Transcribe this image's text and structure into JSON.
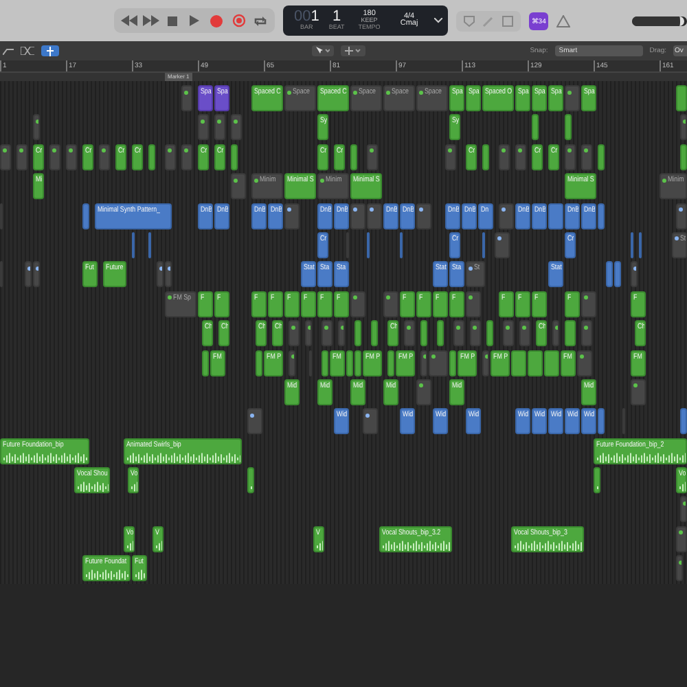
{
  "transport": {
    "buttons": [
      {
        "kind": "rewind"
      },
      {
        "kind": "forward"
      },
      {
        "kind": "stop"
      },
      {
        "kind": "play"
      },
      {
        "kind": "record"
      },
      {
        "kind": "replace"
      },
      {
        "kind": "cycle"
      }
    ]
  },
  "lcd": {
    "bar_dim": "00",
    "bar": "1",
    "beat": "1",
    "bar_label": "BAR",
    "beat_label": "BEAT",
    "tempo": "180",
    "tempo_mode": "KEEP",
    "tempo_label": "TEMPO",
    "signature": "4/4",
    "key": "Cmaj"
  },
  "badge": "⌘34",
  "master_volume": {
    "level": 0.95
  },
  "edit_bar": {
    "snap_label": "Snap:",
    "snap_value": "Smart",
    "drag_label": "Drag:",
    "drag_value": "Ov"
  },
  "ruler": [
    "1",
    "17",
    "33",
    "49",
    "65",
    "81",
    "97",
    "113",
    "129",
    "145",
    "161"
  ],
  "marker": {
    "label": "Marker 1"
  },
  "tracks": [
    {
      "kind": "synth",
      "regions": [
        {
          "kind": "muted"
        },
        {
          "kind": "drum",
          "label": "Spa"
        },
        {
          "kind": "drum",
          "label": "Spa"
        },
        {
          "kind": "midi",
          "label": "Spaced C"
        },
        {
          "kind": "muted",
          "label": "Space"
        },
        {
          "kind": "midi",
          "label": "Spaced C"
        },
        {
          "kind": "muted",
          "label": "Space"
        },
        {
          "kind": "muted",
          "label": "Space"
        },
        {
          "kind": "muted",
          "label": "Space"
        },
        {
          "kind": "midi",
          "label": "Spa"
        },
        {
          "kind": "midi",
          "label": "Spa"
        },
        {
          "kind": "midi",
          "label": "Spaced O"
        },
        {
          "kind": "midi",
          "label": "Spa"
        },
        {
          "kind": "midi",
          "label": "Spa"
        },
        {
          "kind": "midi",
          "label": "Spa"
        },
        {
          "kind": "muted"
        },
        {
          "kind": "midi",
          "label": "Spa"
        },
        {
          "kind": "midi"
        }
      ]
    },
    {
      "kind": "synth",
      "regions": [
        {
          "kind": "muted"
        },
        {
          "kind": "muted"
        },
        {
          "kind": "muted"
        },
        {
          "kind": "muted"
        },
        {
          "kind": "midi",
          "label": "Sy"
        },
        {
          "kind": "midi",
          "label": "Sy"
        },
        {
          "kind": "midi"
        },
        {
          "kind": "midi"
        },
        {
          "kind": "muted"
        }
      ]
    },
    {
      "kind": "synth",
      "regions": [
        {
          "kind": "muted"
        },
        {
          "kind": "muted"
        },
        {
          "kind": "midi",
          "label": "Cr"
        },
        {
          "kind": "muted"
        },
        {
          "kind": "muted"
        },
        {
          "kind": "midi",
          "label": "Cr"
        },
        {
          "kind": "muted"
        },
        {
          "kind": "midi",
          "label": "Cr"
        },
        {
          "kind": "midi",
          "label": "Cr"
        },
        {
          "kind": "midi"
        },
        {
          "kind": "muted"
        },
        {
          "kind": "muted"
        },
        {
          "kind": "midi",
          "label": "Cr"
        },
        {
          "kind": "midi",
          "label": "Cr"
        },
        {
          "kind": "midi"
        },
        {
          "kind": "midi",
          "label": "Cr"
        },
        {
          "kind": "midi",
          "label": "Cr"
        },
        {
          "kind": "midi"
        },
        {
          "kind": "muted"
        },
        {
          "kind": "muted"
        },
        {
          "kind": "midi",
          "label": "Cr"
        },
        {
          "kind": "midi"
        },
        {
          "kind": "muted"
        },
        {
          "kind": "muted"
        },
        {
          "kind": "midi",
          "label": "Cr"
        },
        {
          "kind": "midi",
          "label": "Cr"
        },
        {
          "kind": "muted"
        },
        {
          "kind": "muted"
        },
        {
          "kind": "midi"
        },
        {
          "kind": "midi"
        }
      ]
    },
    {
      "kind": "synth",
      "regions": [
        {
          "kind": "midi",
          "label": "Mi"
        },
        {
          "kind": "muted"
        },
        {
          "kind": "muted",
          "label": "Minim"
        },
        {
          "kind": "midi",
          "label": "Minimal S"
        },
        {
          "kind": "muted",
          "label": "Minim"
        },
        {
          "kind": "midi",
          "label": "Minimal S"
        },
        {
          "kind": "midi",
          "label": "Minimal S"
        },
        {
          "kind": "muted",
          "label": "Minim"
        }
      ]
    },
    {
      "kind": "pattern",
      "regions": [
        {
          "kind": "muted"
        },
        {
          "kind": "pattern"
        },
        {
          "kind": "pattern",
          "label": "Minimal Synth Pattern_"
        },
        {
          "kind": "pattern",
          "label": "DnB"
        },
        {
          "kind": "pattern",
          "label": "DnB"
        },
        {
          "kind": "pattern",
          "label": "DnB"
        },
        {
          "kind": "pattern",
          "label": "DnB"
        },
        {
          "kind": "muted"
        },
        {
          "kind": "pattern",
          "label": "DnB"
        },
        {
          "kind": "pattern",
          "label": "DnB"
        },
        {
          "kind": "muted"
        },
        {
          "kind": "muted"
        },
        {
          "kind": "pattern",
          "label": "DnB"
        },
        {
          "kind": "pattern",
          "label": "DnB"
        },
        {
          "kind": "muted"
        },
        {
          "kind": "pattern",
          "label": "DnB"
        },
        {
          "kind": "pattern",
          "label": "DnB"
        },
        {
          "kind": "pattern",
          "label": "Dn"
        },
        {
          "kind": "muted"
        },
        {
          "kind": "pattern",
          "label": "DnB"
        },
        {
          "kind": "pattern",
          "label": "DnB"
        },
        {
          "kind": "pattern"
        },
        {
          "kind": "pattern",
          "label": "DnB"
        },
        {
          "kind": "pattern",
          "label": "DnB"
        },
        {
          "kind": "pattern"
        },
        {
          "kind": "muted"
        }
      ]
    },
    {
      "kind": "pattern",
      "regions": [
        {
          "kind": "pattern"
        },
        {
          "kind": "pattern"
        },
        {
          "kind": "pattern",
          "label": "Cr"
        },
        {
          "kind": "muted"
        },
        {
          "kind": "pattern"
        },
        {
          "kind": "pattern"
        },
        {
          "kind": "pattern",
          "label": "Cr"
        },
        {
          "kind": "pattern"
        },
        {
          "kind": "muted"
        },
        {
          "kind": "pattern",
          "label": "Cr"
        },
        {
          "kind": "pattern"
        },
        {
          "kind": "pattern"
        },
        {
          "kind": "muted",
          "label": "St"
        }
      ]
    },
    {
      "kind": "pattern",
      "regions": [
        {
          "kind": "muted"
        },
        {
          "kind": "muted"
        },
        {
          "kind": "muted"
        },
        {
          "kind": "midi",
          "label": "Fut"
        },
        {
          "kind": "midi",
          "label": "Future"
        },
        {
          "kind": "muted"
        },
        {
          "kind": "muted"
        },
        {
          "kind": "pattern",
          "label": "Stat"
        },
        {
          "kind": "pattern",
          "label": "Sta"
        },
        {
          "kind": "pattern",
          "label": "Sta"
        },
        {
          "kind": "pattern",
          "label": "Stat"
        },
        {
          "kind": "pattern",
          "label": "Sta"
        },
        {
          "kind": "muted",
          "label": "St"
        },
        {
          "kind": "pattern",
          "label": "Stat"
        },
        {
          "kind": "pattern"
        },
        {
          "kind": "pattern"
        },
        {
          "kind": "muted"
        }
      ]
    },
    {
      "kind": "synth",
      "regions": [
        {
          "kind": "muted",
          "label": "FM Sp"
        },
        {
          "kind": "midi",
          "label": "F"
        },
        {
          "kind": "midi",
          "label": "F"
        },
        {
          "kind": "midi",
          "label": "F"
        },
        {
          "kind": "midi",
          "label": "F"
        },
        {
          "kind": "midi",
          "label": "F"
        },
        {
          "kind": "midi",
          "label": "F"
        },
        {
          "kind": "midi",
          "label": "F"
        },
        {
          "kind": "midi",
          "label": "F"
        },
        {
          "kind": "muted"
        },
        {
          "kind": "muted"
        },
        {
          "kind": "midi",
          "label": "F"
        },
        {
          "kind": "midi",
          "label": "F"
        },
        {
          "kind": "midi",
          "label": "F"
        },
        {
          "kind": "midi",
          "label": "F"
        },
        {
          "kind": "muted"
        },
        {
          "kind": "midi",
          "label": "F"
        },
        {
          "kind": "midi",
          "label": "F"
        },
        {
          "kind": "midi",
          "label": "F"
        },
        {
          "kind": "midi",
          "label": "F"
        },
        {
          "kind": "muted"
        },
        {
          "kind": "midi",
          "label": "F"
        }
      ]
    },
    {
      "kind": "synth",
      "regions": [
        {
          "kind": "midi",
          "label": "Ch"
        },
        {
          "kind": "midi",
          "label": "Ch"
        },
        {
          "kind": "midi",
          "label": "Ch"
        },
        {
          "kind": "midi",
          "label": "Ch"
        },
        {
          "kind": "muted"
        },
        {
          "kind": "muted"
        },
        {
          "kind": "muted"
        },
        {
          "kind": "muted"
        },
        {
          "kind": "midi"
        },
        {
          "kind": "midi"
        },
        {
          "kind": "midi",
          "label": "Ch"
        },
        {
          "kind": "muted"
        },
        {
          "kind": "midi"
        },
        {
          "kind": "midi"
        },
        {
          "kind": "muted"
        },
        {
          "kind": "muted"
        },
        {
          "kind": "midi"
        },
        {
          "kind": "muted"
        },
        {
          "kind": "muted"
        },
        {
          "kind": "midi",
          "label": "Ch"
        },
        {
          "kind": "muted"
        },
        {
          "kind": "midi"
        },
        {
          "kind": "muted"
        },
        {
          "kind": "midi",
          "label": "Ch"
        }
      ]
    },
    {
      "kind": "synth",
      "regions": [
        {
          "kind": "midi"
        },
        {
          "kind": "midi",
          "label": "FM"
        },
        {
          "kind": "midi"
        },
        {
          "kind": "midi",
          "label": "FM P"
        },
        {
          "kind": "muted"
        },
        {
          "kind": "muted"
        },
        {
          "kind": "midi"
        },
        {
          "kind": "midi",
          "label": "FM"
        },
        {
          "kind": "midi"
        },
        {
          "kind": "midi"
        },
        {
          "kind": "midi",
          "label": "FM P"
        },
        {
          "kind": "midi"
        },
        {
          "kind": "midi",
          "label": "FM P"
        },
        {
          "kind": "muted"
        },
        {
          "kind": "muted"
        },
        {
          "kind": "midi"
        },
        {
          "kind": "midi",
          "label": "FM P"
        },
        {
          "kind": "muted"
        },
        {
          "kind": "midi",
          "label": "FM P"
        },
        {
          "kind": "midi"
        },
        {
          "kind": "midi"
        },
        {
          "kind": "midi"
        },
        {
          "kind": "midi",
          "label": "FM"
        },
        {
          "kind": "muted"
        },
        {
          "kind": "midi",
          "label": "FM"
        }
      ]
    },
    {
      "kind": "synth",
      "regions": [
        {
          "kind": "midi",
          "label": "Mid"
        },
        {
          "kind": "midi",
          "label": "Mid"
        },
        {
          "kind": "midi",
          "label": "Mid"
        },
        {
          "kind": "midi",
          "label": "Mid"
        },
        {
          "kind": "muted"
        },
        {
          "kind": "midi",
          "label": "Mid"
        },
        {
          "kind": "midi",
          "label": "Mid"
        },
        {
          "kind": "muted"
        }
      ]
    },
    {
      "kind": "pattern",
      "regions": [
        {
          "kind": "muted"
        },
        {
          "kind": "pattern",
          "label": "Wid"
        },
        {
          "kind": "muted"
        },
        {
          "kind": "pattern",
          "label": "Wid"
        },
        {
          "kind": "pattern",
          "label": "Wid"
        },
        {
          "kind": "pattern",
          "label": "Wid"
        },
        {
          "kind": "pattern",
          "label": "Wid"
        },
        {
          "kind": "pattern",
          "label": "Wid"
        },
        {
          "kind": "pattern",
          "label": "Wid"
        },
        {
          "kind": "pattern",
          "label": "Wid"
        },
        {
          "kind": "pattern",
          "label": "Wid"
        },
        {
          "kind": "pattern"
        },
        {
          "kind": "muted"
        },
        {
          "kind": "pattern"
        }
      ]
    },
    {
      "regions": [
        {
          "kind": "audio",
          "label": "Future Foundation_bip"
        },
        {
          "kind": "audio",
          "label": "Animated Swirls_bip"
        },
        {
          "kind": "audio",
          "label": "Future Foundation_bip_2"
        }
      ]
    },
    {
      "regions": [
        {
          "kind": "audio",
          "label": "Vocal Shou"
        },
        {
          "kind": "audio",
          "label": "Vo"
        },
        {
          "kind": "audio"
        },
        {
          "kind": "audio"
        },
        {
          "kind": "audio",
          "label": "Vo"
        }
      ]
    },
    {
      "kind": "synth",
      "regions": [
        {
          "kind": "muted"
        }
      ]
    },
    {
      "kind": "synth",
      "regions": [
        {
          "kind": "audio",
          "label": "Vo"
        },
        {
          "kind": "audio",
          "label": "V"
        },
        {
          "kind": "audio",
          "label": "V"
        },
        {
          "kind": "audio",
          "label": "Vocal Shouts_bip_3.2"
        },
        {
          "kind": "audio",
          "label": "Vocal Shouts_bip_3"
        },
        {
          "kind": "muted"
        }
      ]
    },
    {
      "kind": "synth",
      "regions": [
        {
          "kind": "audio",
          "label": "Future Foundat"
        },
        {
          "kind": "audio",
          "label": "Fut"
        },
        {
          "kind": "muted"
        }
      ]
    }
  ]
}
